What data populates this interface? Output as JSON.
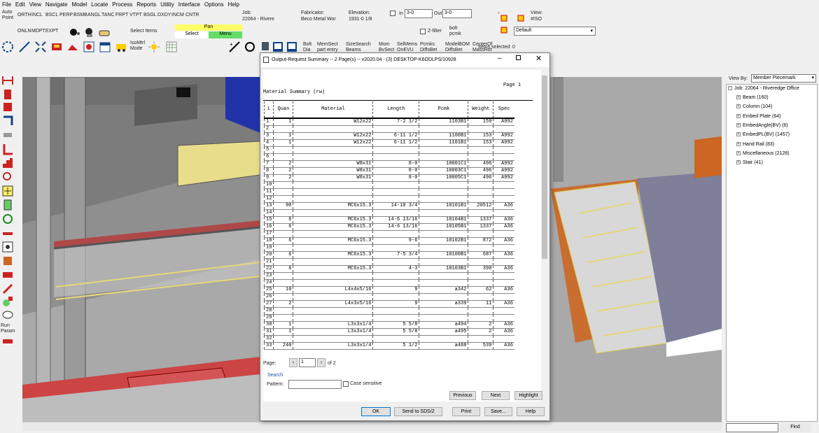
{
  "menu": [
    "File",
    "Edit",
    "View",
    "Navigate",
    "Model",
    "Locate",
    "Process",
    "Reports",
    "Utility",
    "Interface",
    "Options",
    "Help"
  ],
  "toolbar": {
    "auto_point": "Auto\nPoint",
    "snaps_row1": [
      "ORTH",
      "INCL",
      "BSCL",
      "PERP",
      "BSMB",
      "ANGL",
      "TANC",
      "FRPT",
      "VTPT",
      "BSGL",
      "DXDY",
      "INCM",
      "CNTR"
    ],
    "snaps_row2": [
      "ONLN",
      "MDPT",
      "EXPT"
    ],
    "job_label": "Job:",
    "job_value": "22064 - Rivere",
    "fabricator_label": "Fabricator:",
    "fabricator_value": "Beco Metal Wor",
    "elevation_label": "Elevation:",
    "elevation_value": "1931-0 1/8",
    "in_label": "In",
    "in_value": "3-0",
    "out_label": "Out",
    "out_value": "3-0",
    "view_label": "View:",
    "view_value": "#ISO",
    "select_items": "Select Items",
    "pan": "Pan",
    "select": "Select",
    "menu_btn": "Menu",
    "zfilter": "Z-filter",
    "bolt_label": "bolt\npcmk",
    "default_select": "Default",
    "isomtrl": "IsoMtrl\nMode",
    "bolt_dia": "Bolt\nDia",
    "memsect": "MemSect\npart entry",
    "sizesearch": "SizeSearch\nBeams",
    "mom": "Mom\nBvSect",
    "selmems": "SelMems\nOnEVU",
    "pcmks": "Pcmks\nDiffsBet",
    "modelbom": "ModelBOM\nDiffsBet",
    "centerof": "CenterOf\nMassRot",
    "items_selected": "Items selected: 0"
  },
  "left_toolbar": {
    "run_param": "Run\nParam"
  },
  "right_panel": {
    "viewby_label": "View By:",
    "viewby_value": "Member Piecemark",
    "tree_root": "Job: 22064 - Riveredge Office",
    "tree_items": [
      "Beam (160)",
      "Column (104)",
      "Embed Plate (64)",
      "EmbedAngle(BV) (6)",
      "EmbedPL(BV) (1457)",
      "Hand Rail (83)",
      "Miscellaneous (2128)",
      "Stair (41)"
    ],
    "find_button": "Find"
  },
  "dialog": {
    "title": "Output-Request Summary  --  2 Page(s)  --  v2020.04 - (3) DESKTOP-K6ODLPS/10928",
    "page_header": "Page    1",
    "report_title": "Material Summary (rw)",
    "columns": [
      "L",
      "Quan",
      "Material",
      "Length",
      "Pcmk",
      "Weight",
      "Spec"
    ],
    "rows": [
      [
        "1",
        "1",
        "W12x22",
        "7-2 1/2",
        "1103B1",
        "159",
        "A992"
      ],
      [
        "2",
        "",
        "",
        "",
        "",
        "",
        ""
      ],
      [
        "3",
        "1",
        "W12x22",
        "6-11 1/2",
        "1100B1",
        "153",
        "A992"
      ],
      [
        "4",
        "1",
        "W12x22",
        "6-11 1/2",
        "1101B1",
        "153",
        "A992"
      ],
      [
        "5",
        "",
        "",
        "",
        "",
        "",
        ""
      ],
      [
        "6",
        "",
        "",
        "",
        "",
        "",
        ""
      ],
      [
        "7",
        "2",
        "W8x31",
        "8-0",
        "10001C1",
        "496",
        "A992"
      ],
      [
        "8",
        "2",
        "W8x31",
        "8-0",
        "10003C1",
        "496",
        "A992"
      ],
      [
        "9",
        "2",
        "W8x31",
        "8-0",
        "10005C1",
        "496",
        "A992"
      ],
      [
        "10",
        "",
        "",
        "",
        "",
        "",
        ""
      ],
      [
        "11",
        "",
        "",
        "",
        "",
        "",
        ""
      ],
      [
        "12",
        "",
        "",
        "",
        "",
        "",
        ""
      ],
      [
        "13",
        "90",
        "MC6x15.3",
        "14-10 3/4",
        "10101B1",
        "20512",
        "A36"
      ],
      [
        "14",
        "",
        "",
        "",
        "",
        "",
        ""
      ],
      [
        "15",
        "6",
        "MC6x15.3",
        "14-6 13/16",
        "10104B1",
        "1337",
        "A36"
      ],
      [
        "16",
        "6",
        "MC6x15.3",
        "14-6 13/16",
        "10105B1",
        "1337",
        "A36"
      ],
      [
        "17",
        "",
        "",
        "",
        "",
        "",
        ""
      ],
      [
        "18",
        "6",
        "MC6x15.3",
        "9-6",
        "10102B1",
        "872",
        "A36"
      ],
      [
        "19",
        "",
        "",
        "",
        "",
        "",
        ""
      ],
      [
        "20",
        "6",
        "MC6x15.3",
        "7-5 3/4",
        "10100B1",
        "687",
        "A36"
      ],
      [
        "21",
        "",
        "",
        "",
        "",
        "",
        ""
      ],
      [
        "22",
        "6",
        "MC6x15.3",
        "4-3",
        "10103B1",
        "390",
        "A36"
      ],
      [
        "23",
        "",
        "",
        "",
        "",
        "",
        ""
      ],
      [
        "24",
        "",
        "",
        "",
        "",
        "",
        ""
      ],
      [
        "25",
        "10",
        "L4x4x5/16",
        "9",
        "a342",
        "62",
        "A36"
      ],
      [
        "26",
        "",
        "",
        "",
        "",
        "",
        ""
      ],
      [
        "27",
        "2",
        "L4x3x5/16",
        "9",
        "a339",
        "11",
        "A36"
      ],
      [
        "28",
        "",
        "",
        "",
        "",
        "",
        ""
      ],
      [
        "29",
        "",
        "",
        "",
        "",
        "",
        ""
      ],
      [
        "30",
        "1",
        "L3x3x1/4",
        "5 5/8",
        "a494",
        "2",
        "A36"
      ],
      [
        "31",
        "1",
        "L3x3x1/4",
        "5 5/8",
        "a495",
        "2",
        "A36"
      ],
      [
        "32",
        "",
        "",
        "",
        "",
        "",
        ""
      ],
      [
        "33",
        "240",
        "L3x3x1/4",
        "5 1/2",
        "a488",
        "539",
        "A36"
      ]
    ],
    "page_label": "Page:",
    "page_value": "1",
    "of_pages": "of 2",
    "search_label": "Search",
    "pattern_label": "Pattern:",
    "pattern_value": "",
    "case_sensitive": "Case sensitive",
    "previous": "Previous",
    "next": "Next",
    "highlight": "Highlight",
    "ok": "OK",
    "send_sds2": "Send to SDS/2",
    "print": "Print",
    "save": "Save...",
    "help": "Help"
  }
}
